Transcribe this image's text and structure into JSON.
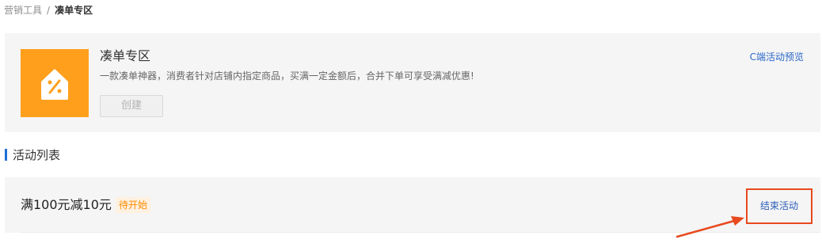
{
  "breadcrumb": {
    "parent": "营销工具",
    "separator": "/",
    "current": "凑单专区"
  },
  "intro": {
    "logo_icon": "percent-tag-icon",
    "title": "凑单专区",
    "description": "一款凑单神器，消费者针对店铺内指定商品，买满一定金额后，合并下单可享受满减优惠!",
    "create_label": "创建",
    "preview_link": "C端活动预览"
  },
  "section": {
    "title": "活动列表"
  },
  "activities": [
    {
      "name": "满100元减10元",
      "status": "待开始",
      "action_label": "结束活动"
    }
  ],
  "colors": {
    "brand_orange": "#ff9f1c",
    "link_blue": "#2c69c9",
    "status_orange": "#ff8b00",
    "annotation_red": "#e8491e",
    "panel_bg": "#f5f5f5"
  }
}
